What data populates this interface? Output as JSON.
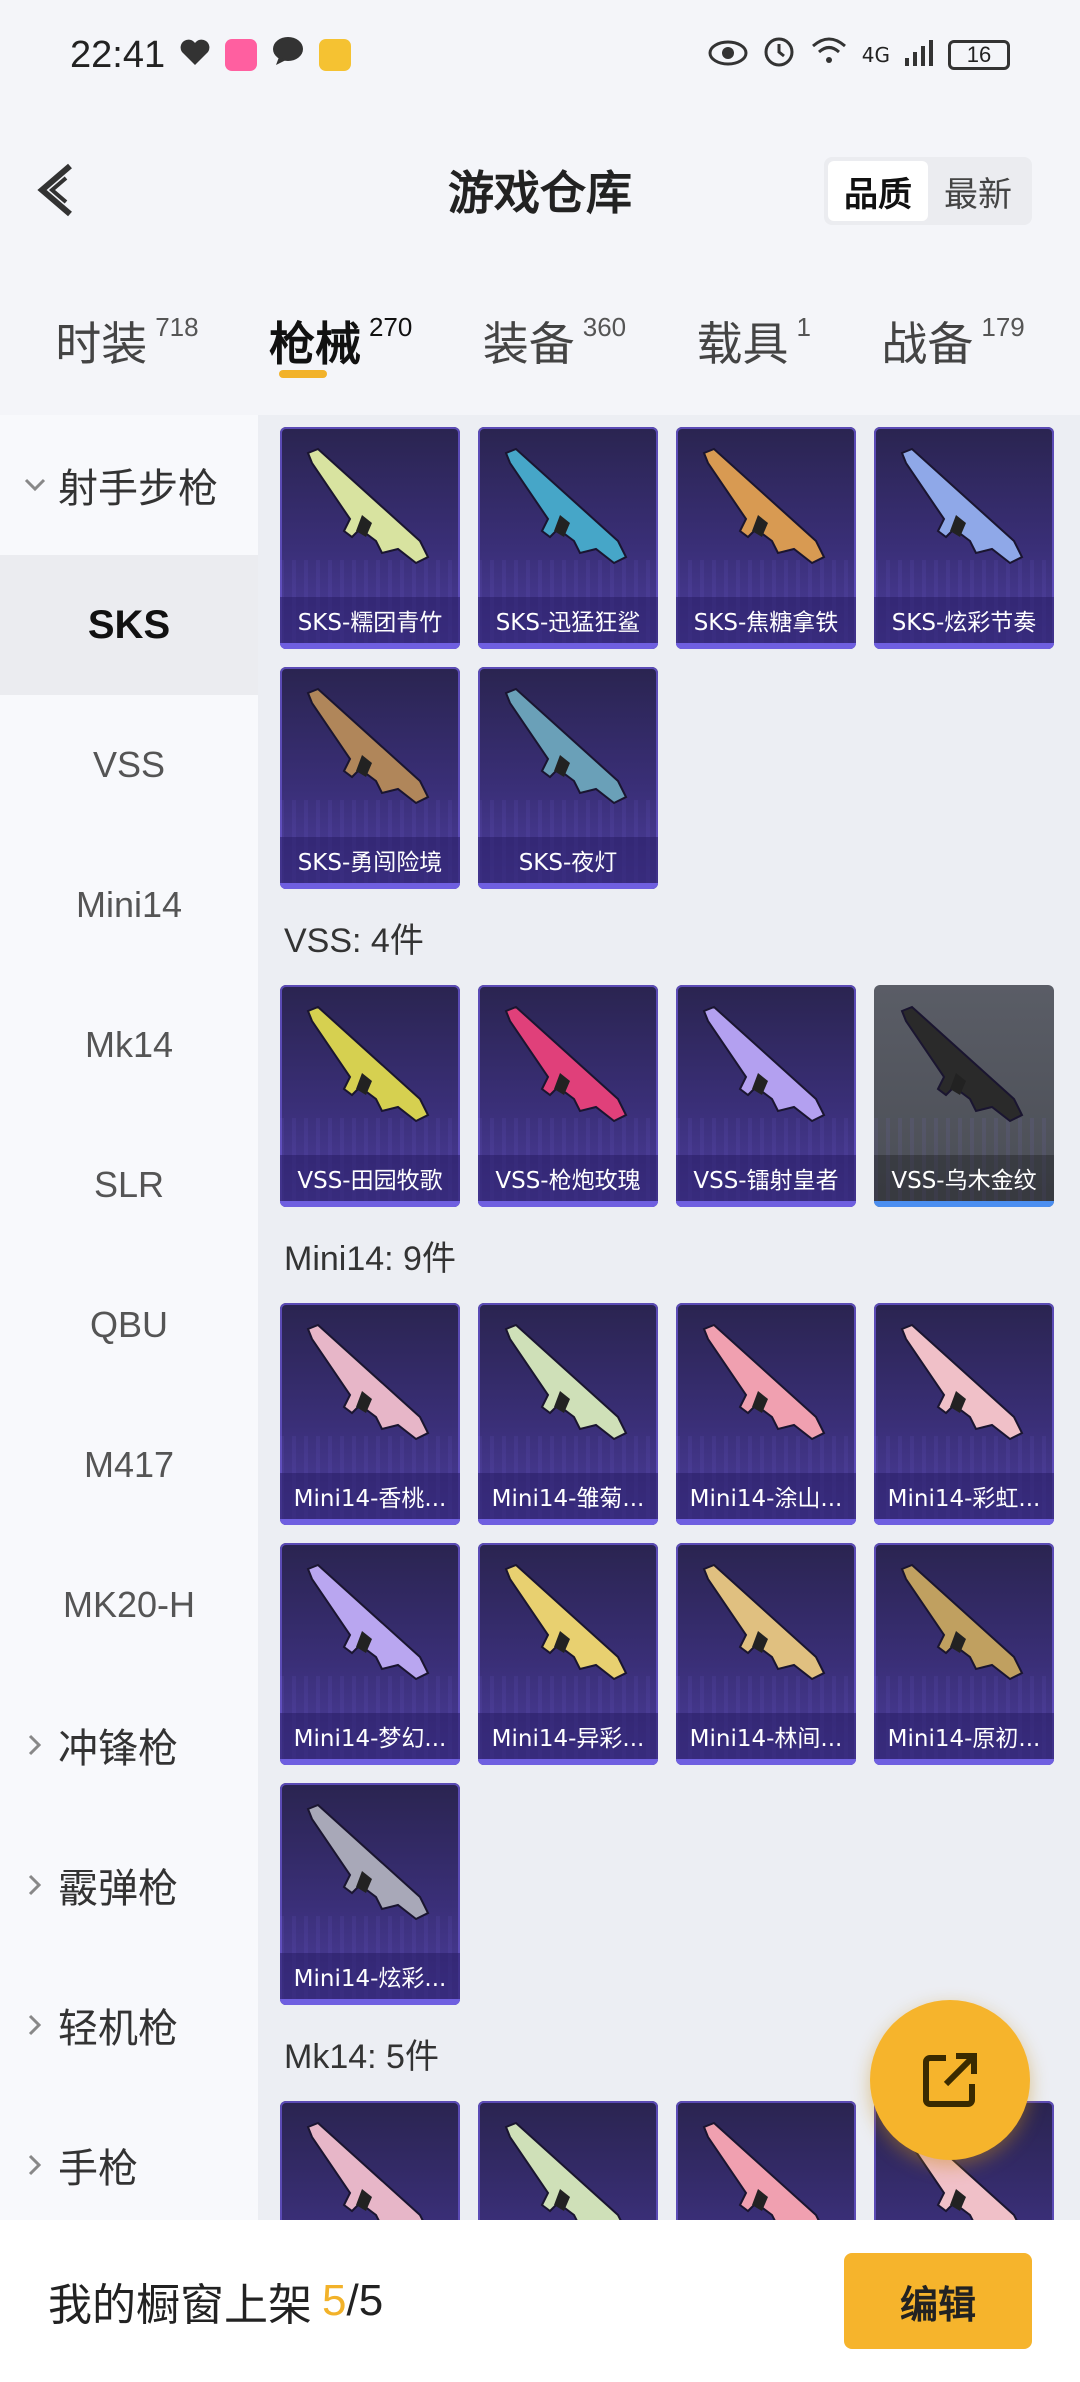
{
  "status_bar": {
    "time": "22:41",
    "network": "4G",
    "battery": "16",
    "icons": [
      "heart-icon",
      "app-badge-icon",
      "chat-icon",
      "mail-icon",
      "eye-icon",
      "alarm-icon",
      "wifi-icon",
      "signal-icon",
      "battery-icon"
    ]
  },
  "header": {
    "title": "游戏仓库",
    "sort_options": [
      "品质",
      "最新"
    ],
    "sort_active": "品质"
  },
  "tabs": [
    {
      "label": "时装",
      "count": "718"
    },
    {
      "label": "枪械",
      "count": "270",
      "active": true
    },
    {
      "label": "装备",
      "count": "360"
    },
    {
      "label": "载具",
      "count": "1"
    },
    {
      "label": "战备",
      "count": "179"
    }
  ],
  "sidebar": {
    "expanded_group": "射手步枪",
    "items": [
      "SKS",
      "VSS",
      "Mini14",
      "Mk14",
      "SLR",
      "QBU",
      "M417",
      "MK20-H"
    ],
    "active_item": "SKS",
    "collapsed_groups": [
      "冲锋枪",
      "霰弹枪",
      "轻机枪",
      "手枪"
    ]
  },
  "sections": [
    {
      "title": "",
      "items": [
        "SKS-糯团青竹",
        "SKS-迅猛狂鲨",
        "SKS-焦糖拿铁",
        "SKS-炫彩节奏",
        "SKS-勇闯险境",
        "SKS-夜灯"
      ]
    },
    {
      "title": "VSS: 4件",
      "items": [
        "VSS-田园牧歌",
        "VSS-枪炮玫瑰",
        "VSS-镭射皇者",
        "VSS-乌木金纹"
      ]
    },
    {
      "title": "Mini14: 9件",
      "items": [
        "Mini14-香桃...",
        "Mini14-雏菊...",
        "Mini14-涂山...",
        "Mini14-彩虹...",
        "Mini14-梦幻...",
        "Mini14-异彩...",
        "Mini14-林间...",
        "Mini14-原初...",
        "Mini14-炫彩..."
      ]
    },
    {
      "title": "Mk14: 5件",
      "items": [
        "",
        "",
        "",
        ""
      ]
    }
  ],
  "gun_colors": {
    "SKS-糯团青竹": "#d8e3a0",
    "SKS-迅猛狂鲨": "#46a6c8",
    "SKS-焦糖拿铁": "#d89a52",
    "SKS-炫彩节奏": "#8fa8e8",
    "SKS-勇闯险境": "#b0865a",
    "SKS-夜灯": "#6aa0b8",
    "VSS-田园牧歌": "#d6d050",
    "VSS-枪炮玫瑰": "#e0407a",
    "VSS-镭射皇者": "#b3a0f0",
    "VSS-乌木金纹": "#2a2a2a"
  },
  "bottom": {
    "label": "我的橱窗上架",
    "current": "5",
    "total": "/5",
    "edit_label": "编辑"
  },
  "accent_color": "#f6b42c"
}
